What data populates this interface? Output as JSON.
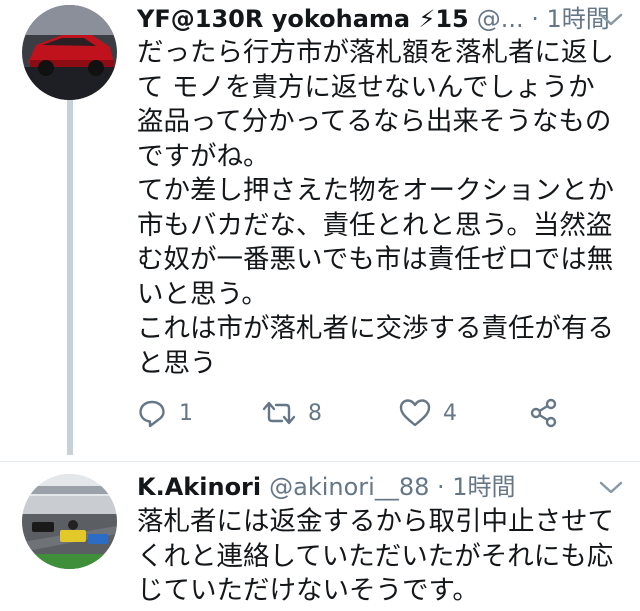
{
  "tweets": [
    {
      "display_name": "YF@130R yokohama ⚡15",
      "handle_time": "@... · 1時間",
      "text": "だったら行方市が落札額を落札者に返して モノを貴方に返せないんでしょうか\n盗品って分かってるなら出来そうなものですがね。\nてか差し押さえた物をオークションとか市もバカだな、責任とれと思う。当然盗む奴が一番悪いでも市は責任ゼロでは無いと思う。\nこれは市が落札者に交渉する責任が有ると思う",
      "reply_count": "1",
      "retweet_count": "8",
      "like_count": "4"
    },
    {
      "display_name": "K.Akinori",
      "handle_time": "@akinori__88 · 1時間",
      "text": "落札者には返金するから取引中止させてくれと連絡していただいたがそれにも応じていただけないそうです。"
    }
  ],
  "icons": {
    "reply": "reply-icon",
    "retweet": "retweet-icon",
    "like": "heart-icon",
    "share": "share-icon",
    "menu": "chevron-down-icon"
  },
  "colors": {
    "text_primary": "#14171a",
    "text_secondary": "#657786",
    "thread_line": "#c8d1d8",
    "divider": "#e6ecf0"
  }
}
